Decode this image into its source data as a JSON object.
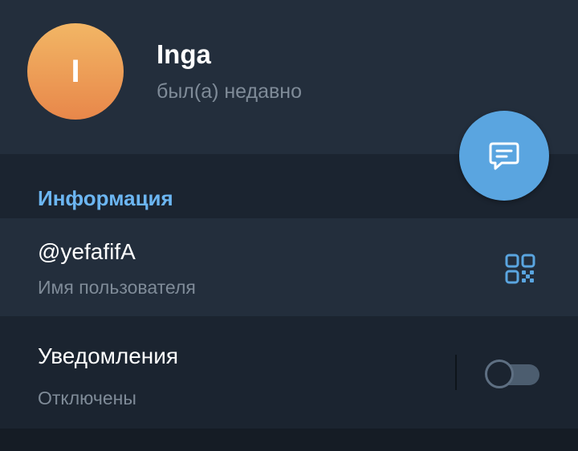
{
  "profile": {
    "avatar_initial": "I",
    "name": "Inga",
    "status": "был(а) недавно"
  },
  "section": {
    "title": "Информация"
  },
  "username_row": {
    "value": "@yefafifA",
    "caption": "Имя пользователя",
    "icon": "qr-code-icon"
  },
  "notifications_row": {
    "label": "Уведомления",
    "caption": "Отключены",
    "toggle_on": false
  },
  "fab": {
    "icon": "message-icon"
  },
  "colors": {
    "background": "#1b2430",
    "card": "#232e3c",
    "accent": "#5aa5e0",
    "section_title": "#6cb6f2",
    "avatar_gradient_top": "#f2b665",
    "avatar_gradient_bottom": "#e8874a",
    "muted_text": "#7f8b98"
  }
}
